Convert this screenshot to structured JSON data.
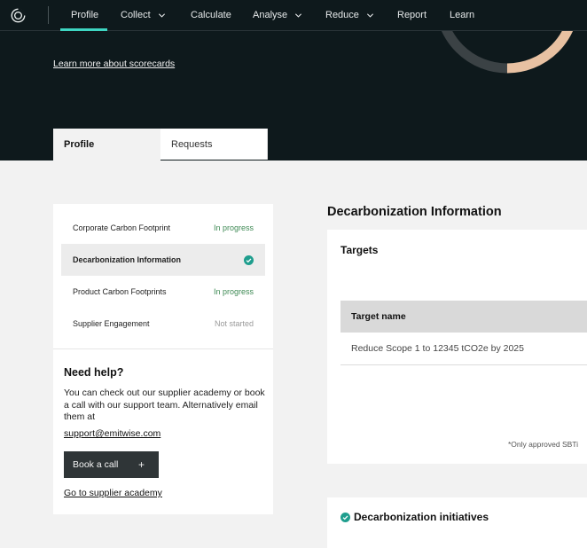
{
  "nav": {
    "items": [
      {
        "label": "Profile",
        "dropdown": false,
        "active": true
      },
      {
        "label": "Collect",
        "dropdown": true
      },
      {
        "label": "Calculate",
        "dropdown": false
      },
      {
        "label": "Analyse",
        "dropdown": true
      },
      {
        "label": "Reduce",
        "dropdown": true
      },
      {
        "label": "Report",
        "dropdown": false
      },
      {
        "label": "Learn",
        "dropdown": false
      }
    ],
    "accent_color": "#3ed6c2"
  },
  "hero": {
    "learn_link": "Learn more about scorecards",
    "donut_colors": [
      "#3b4245",
      "#e8c1a2"
    ]
  },
  "tabs": {
    "profile": "Profile",
    "requests": "Requests"
  },
  "sidebar": {
    "items": [
      {
        "label": "Corporate Carbon Footprint",
        "status": "In progress"
      },
      {
        "label": "Decarbonization Information",
        "status": "",
        "icon": "check-circle-icon",
        "selected": true
      },
      {
        "label": "Product Carbon Footprints",
        "status": "In progress"
      },
      {
        "label": "Supplier Engagement",
        "status": "Not started"
      }
    ]
  },
  "help": {
    "title": "Need help?",
    "text": "You can check out our supplier academy or book a call with our support team. Alternatively email them at",
    "email": "support@emitwise.com",
    "book_button": "Book a call",
    "academy_link": "Go to supplier academy"
  },
  "main": {
    "section_title": "Decarbonization Information",
    "targets": {
      "title": "Targets",
      "column_header": "Target name",
      "rows": [
        "Reduce Scope 1 to 12345 tCO2e by 2025"
      ],
      "note": "*Only approved SBTi"
    },
    "initiatives": {
      "title": "Decarbonization initiatives"
    }
  }
}
